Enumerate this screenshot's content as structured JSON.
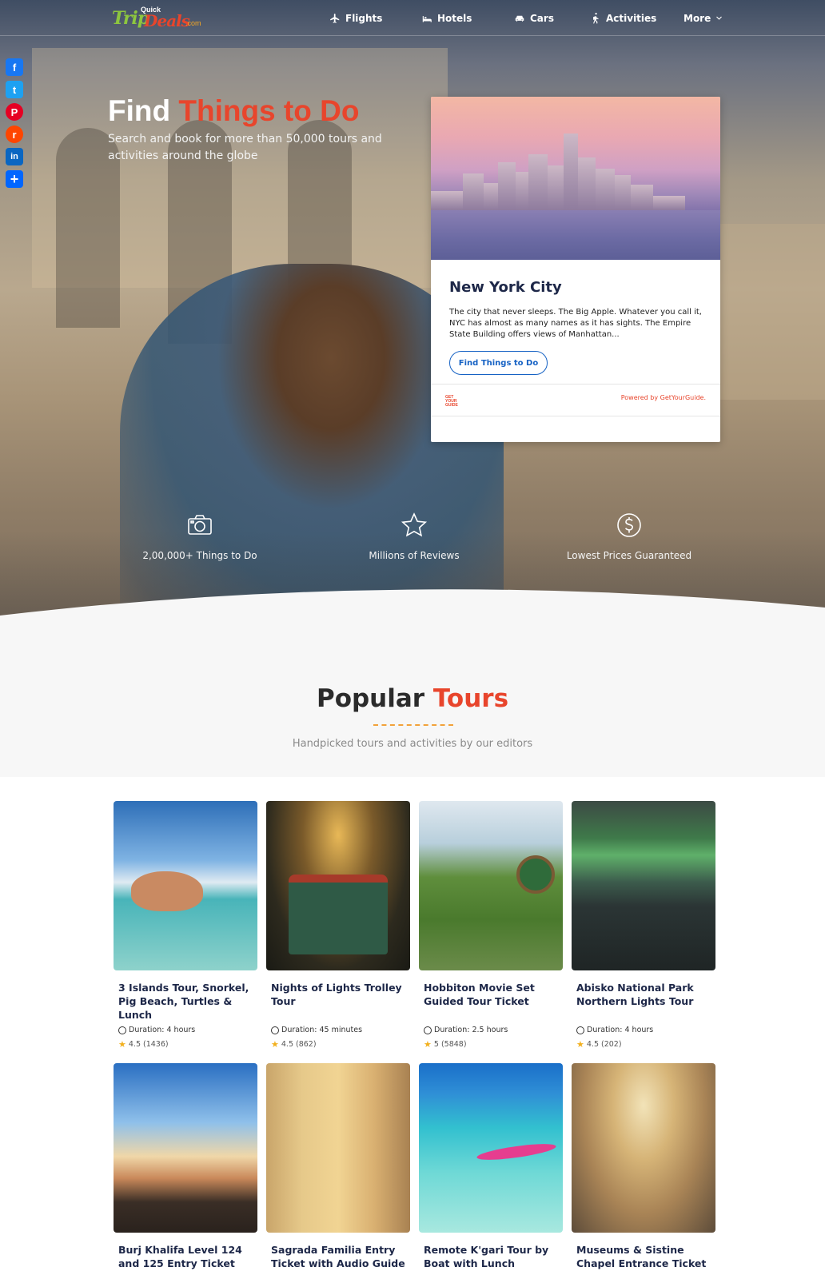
{
  "header": {
    "logo": {
      "trip": "Trip",
      "quick": "Quick",
      "deals": "Deals",
      "com": ".com"
    },
    "nav": [
      {
        "label": "Flights",
        "icon": "plane-icon"
      },
      {
        "label": "Hotels",
        "icon": "bed-icon"
      },
      {
        "label": "Cars",
        "icon": "car-icon"
      },
      {
        "label": "Activities",
        "icon": "hiking-icon"
      },
      {
        "label": "More",
        "icon": "chevron-down-icon"
      }
    ]
  },
  "social": [
    {
      "name": "Facebook",
      "color": "#1877f2",
      "glyph": "f"
    },
    {
      "name": "Twitter",
      "color": "#1da1f2",
      "glyph": "t"
    },
    {
      "name": "Pinterest",
      "color": "#e60023",
      "glyph": "P"
    },
    {
      "name": "Reddit",
      "color": "#ff4500",
      "glyph": "r"
    },
    {
      "name": "LinkedIn",
      "color": "#0a66c2",
      "glyph": "in"
    },
    {
      "name": "Share",
      "color": "#0166ff",
      "glyph": "+"
    }
  ],
  "hero": {
    "title_plain": "Find",
    "title_accent": "Things to Do",
    "subtitle": "Search and book for more than 50,000 tours and activities around the globe"
  },
  "card": {
    "title": "New York City",
    "description": "The city that never sleeps. The Big Apple. Whatever you call it, NYC has almost as many names as it has sights. The Empire State Building offers views of Manhattan...",
    "button": "Find Things to Do",
    "logo_text": "GET YOUR GUIDE",
    "powered": "Powered by GetYourGuide."
  },
  "features": [
    {
      "label": "2,00,000+ Things to Do",
      "icon": "camera-icon"
    },
    {
      "label": "Millions of Reviews",
      "icon": "star-icon"
    },
    {
      "label": "Lowest Prices Guaranteed",
      "icon": "dollar-icon"
    }
  ],
  "popular": {
    "title_plain": "Popular",
    "title_accent": "Tours",
    "subtitle": "Handpicked tours and activities by our editors"
  },
  "tours": [
    {
      "name": "3 Islands Tour, Snorkel, Pig Beach, Turtles & Lunch",
      "duration": "Duration: 4 hours",
      "rating": "4.5 (1436)"
    },
    {
      "name": "Nights of Lights Trolley Tour",
      "duration": "Duration: 45 minutes",
      "rating": "4.5 (862)"
    },
    {
      "name": "Hobbiton Movie Set Guided Tour Ticket",
      "duration": "Duration: 2.5 hours",
      "rating": "5 (5848)"
    },
    {
      "name": "Abisko National Park Northern Lights Tour",
      "duration": "Duration: 4 hours",
      "rating": "4.5 (202)"
    },
    {
      "name": "Burj Khalifa Level 124 and 125 Entry Ticket"
    },
    {
      "name": "Sagrada Familia Entry Ticket with Audio Guide"
    },
    {
      "name": "Remote K'gari Tour by Boat with Lunch"
    },
    {
      "name": "Museums & Sistine Chapel Entrance Ticket"
    }
  ],
  "colors": {
    "accent": "#e8452c",
    "navy": "#1d2748",
    "link_blue": "#1662c4",
    "star": "#f2b01e"
  }
}
